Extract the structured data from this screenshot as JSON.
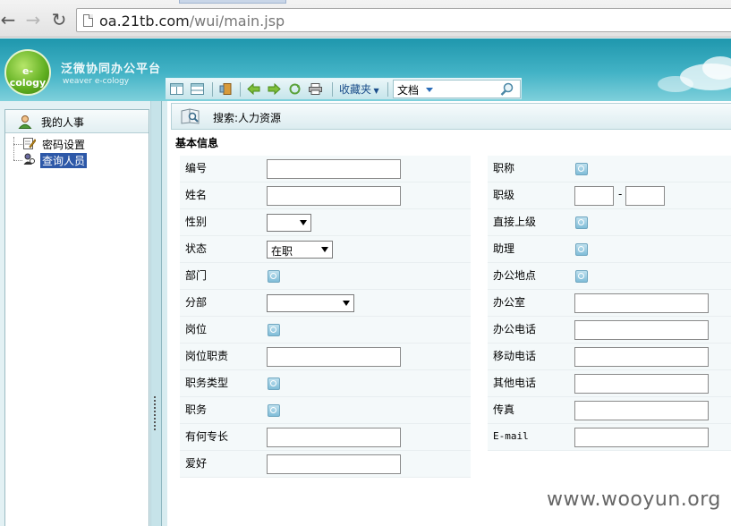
{
  "browser": {
    "url_host": "oa.21tb.com",
    "url_path": "/wui/main.jsp"
  },
  "header": {
    "logo_text": "e-cology",
    "brand_title": "泛微协同办公平台",
    "brand_subtitle": "weaver e-cology",
    "favorites_label": "收藏夹",
    "search_scope": "文档"
  },
  "sidebar": {
    "title": "我的人事",
    "items": [
      {
        "label": "密码设置",
        "selected": false
      },
      {
        "label": "查询人员",
        "selected": true
      }
    ]
  },
  "main": {
    "search_title": "搜索:人力资源",
    "section_title": "基本信息",
    "left_fields": [
      {
        "label": "编号",
        "control": "text"
      },
      {
        "label": "姓名",
        "control": "text"
      },
      {
        "label": "性别",
        "control": "select",
        "value": ""
      },
      {
        "label": "状态",
        "control": "select",
        "value": "在职"
      },
      {
        "label": "部门",
        "control": "browse"
      },
      {
        "label": "分部",
        "control": "select",
        "value": ""
      },
      {
        "label": "岗位",
        "control": "browse"
      },
      {
        "label": "岗位职责",
        "control": "text"
      },
      {
        "label": "职务类型",
        "control": "browse"
      },
      {
        "label": "职务",
        "control": "browse"
      },
      {
        "label": "有何专长",
        "control": "text"
      },
      {
        "label": "爱好",
        "control": "text"
      }
    ],
    "right_fields": [
      {
        "label": "职称",
        "control": "browse"
      },
      {
        "label": "职级",
        "control": "range",
        "separator": "-"
      },
      {
        "label": "直接上级",
        "control": "browse"
      },
      {
        "label": "助理",
        "control": "browse"
      },
      {
        "label": "办公地点",
        "control": "browse"
      },
      {
        "label": "办公室",
        "control": "text"
      },
      {
        "label": "办公电话",
        "control": "text"
      },
      {
        "label": "移动电话",
        "control": "text"
      },
      {
        "label": "其他电话",
        "control": "text"
      },
      {
        "label": "传真",
        "control": "text"
      },
      {
        "label": "E-mail",
        "control": "text"
      }
    ]
  },
  "watermark": "www.wooyun.org"
}
